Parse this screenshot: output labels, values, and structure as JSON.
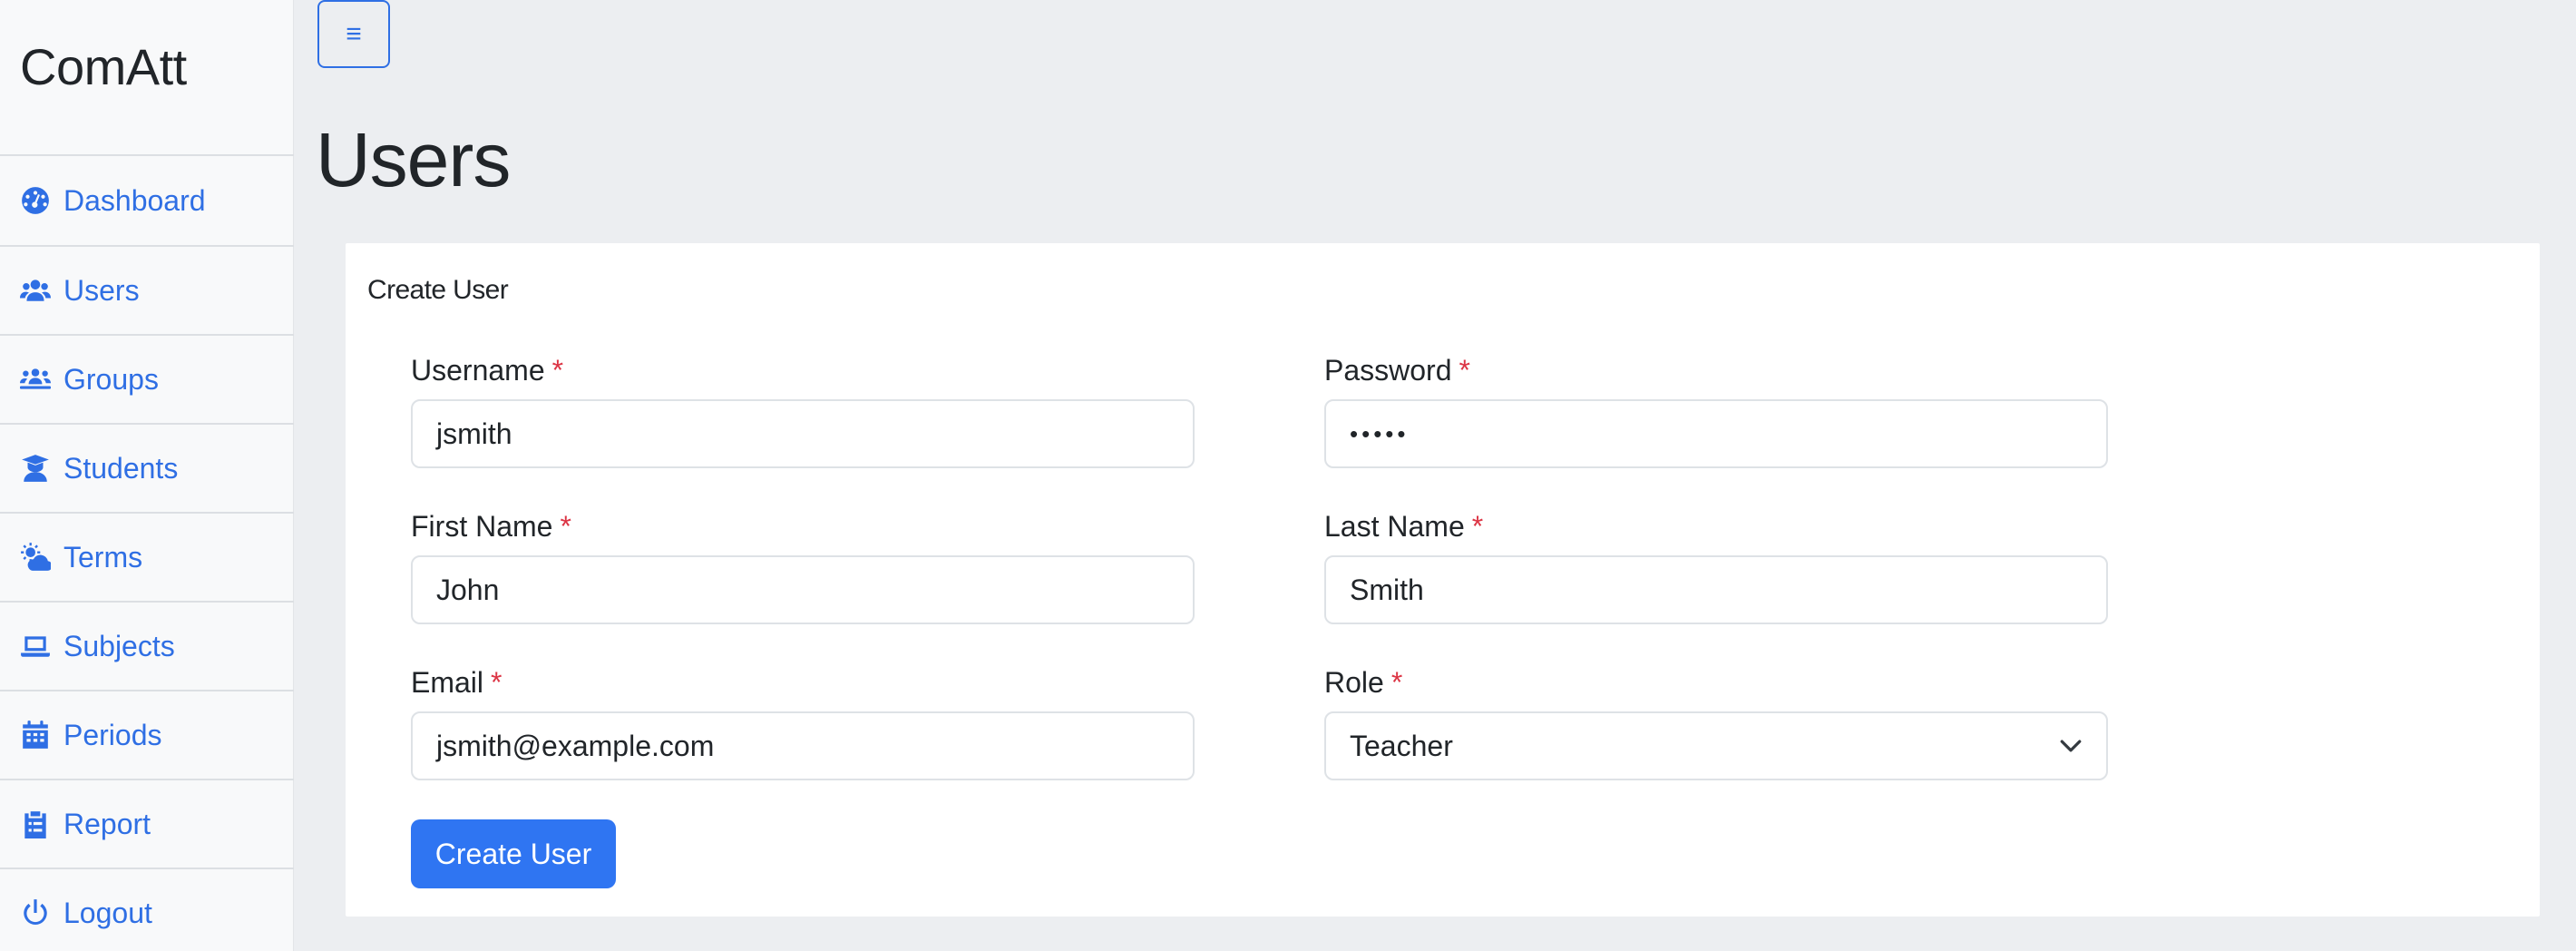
{
  "brand": "ComAtt",
  "nav": [
    {
      "label": "Dashboard",
      "icon": "dashboard-icon"
    },
    {
      "label": "Users",
      "icon": "users-icon"
    },
    {
      "label": "Groups",
      "icon": "groups-icon"
    },
    {
      "label": "Students",
      "icon": "student-icon"
    },
    {
      "label": "Terms",
      "icon": "weather-icon"
    },
    {
      "label": "Subjects",
      "icon": "laptop-icon"
    },
    {
      "label": "Periods",
      "icon": "calendar-icon"
    },
    {
      "label": "Report",
      "icon": "clipboard-list-icon"
    },
    {
      "label": "Logout",
      "icon": "power-icon"
    }
  ],
  "toggle": {
    "glyph": "≡",
    "icon": "hamburger-icon"
  },
  "page_title": "Users",
  "form": {
    "title": "Create User",
    "required_marker": "*",
    "username": {
      "label": "Username",
      "value": "jsmith"
    },
    "password": {
      "label": "Password",
      "value": "•••••"
    },
    "first_name": {
      "label": "First Name",
      "value": "John"
    },
    "last_name": {
      "label": "Last Name",
      "value": "Smith"
    },
    "email": {
      "label": "Email",
      "value": "jsmith@example.com"
    },
    "role": {
      "label": "Role",
      "value": "Teacher"
    },
    "submit_label": "Create User"
  },
  "colors": {
    "accent": "#2f6fe4",
    "primary_button": "#2f75f2",
    "required": "#dc3545",
    "background": "#eceef1",
    "sidebar": "#f8f9fa"
  }
}
